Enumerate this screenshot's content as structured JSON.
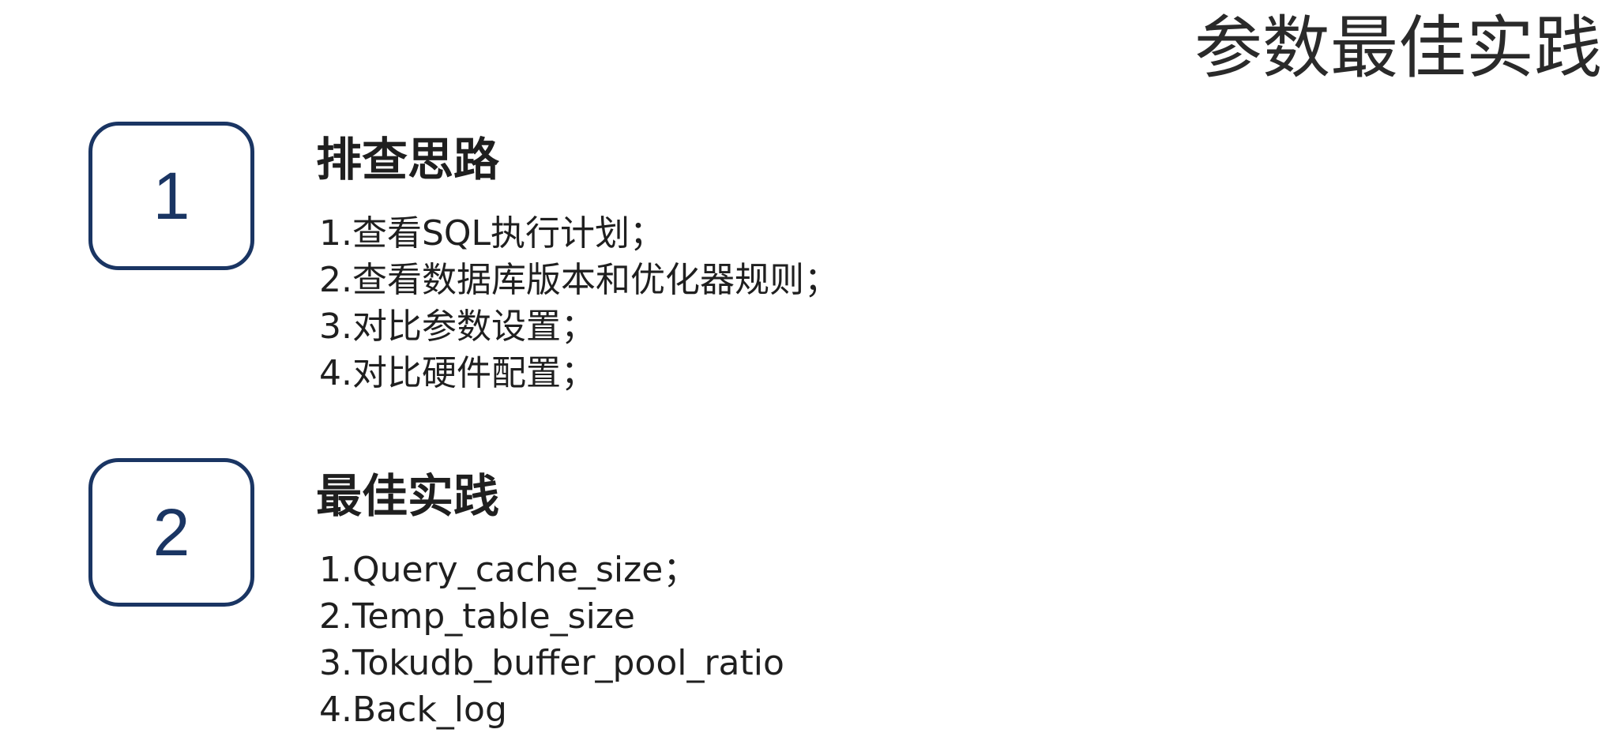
{
  "title": "参数最佳实践",
  "sections": [
    {
      "number": "1",
      "heading": "排查思路",
      "items": [
        "1.查看SQL执行计划；",
        "2.查看数据库版本和优化器规则；",
        "3.对比参数设置；",
        "4.对比硬件配置；"
      ]
    },
    {
      "number": "2",
      "heading": "最佳实践",
      "items": [
        "1.Query_cache_size；",
        "2.Temp_table_size",
        "3.Tokudb_buffer_pool_ratio",
        "4.Back_log"
      ]
    }
  ],
  "colors": {
    "accent": "#1a3563",
    "text": "#1f1f1f",
    "background": "#ffffff"
  }
}
